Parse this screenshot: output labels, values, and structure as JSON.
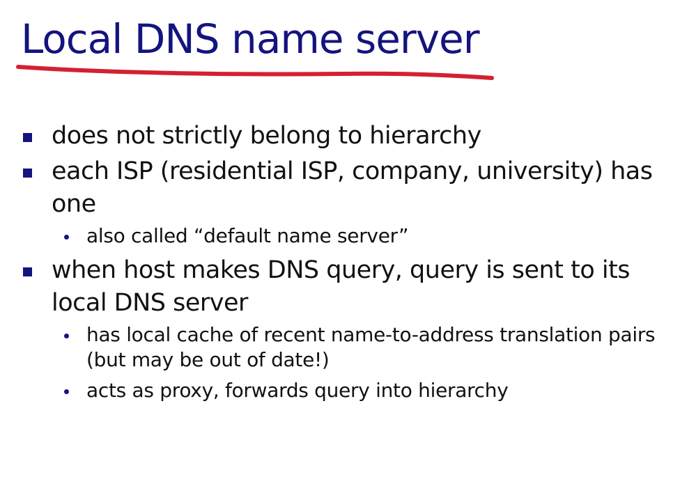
{
  "slide": {
    "title": "Local DNS name server",
    "colors": {
      "title": "#14147e",
      "underline": "#d42030",
      "bullet": "#14147e",
      "text": "#111111"
    },
    "bullets": [
      {
        "text": "does not strictly belong to hierarchy",
        "sub": []
      },
      {
        "text": "each ISP (residential ISP, company, university) has one",
        "sub": [
          "also called “default name server”"
        ]
      },
      {
        "text": "when host makes DNS query, query is sent to its local DNS server",
        "sub": [
          "has local cache of recent name-to-address translation pairs (but may be out of date!)",
          "acts as proxy, forwards query into hierarchy"
        ]
      }
    ]
  }
}
